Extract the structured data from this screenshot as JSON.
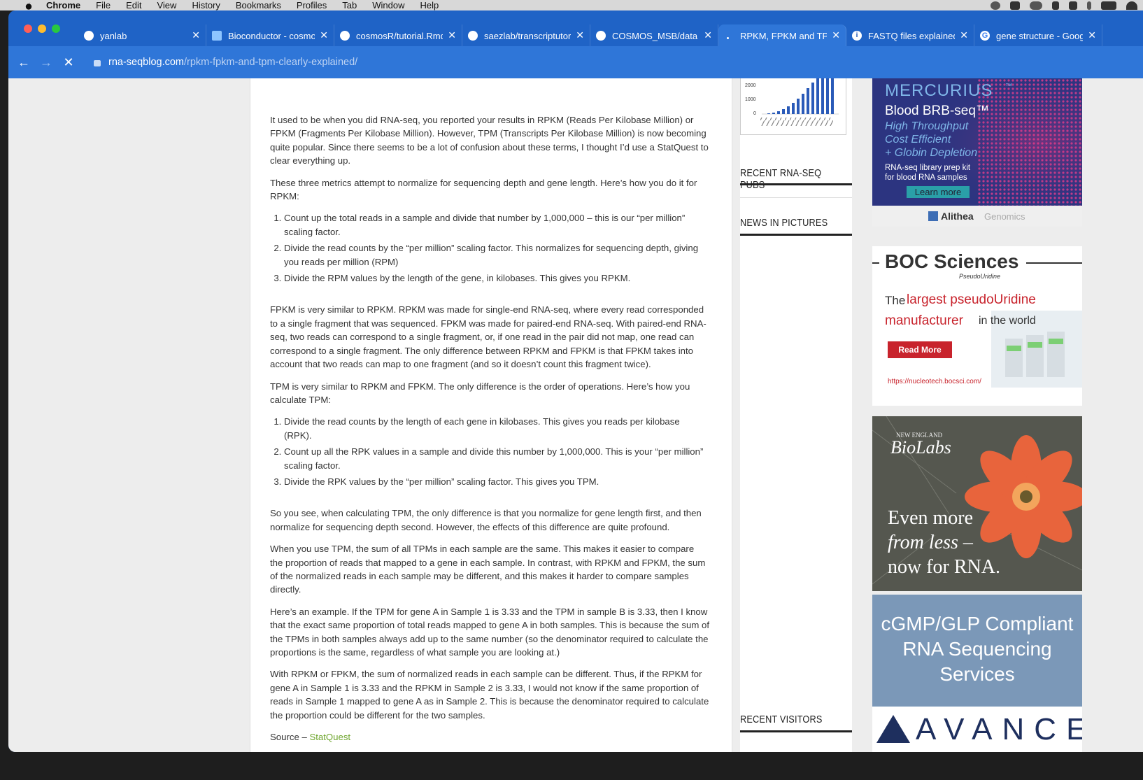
{
  "menubar": {
    "app": "Chrome",
    "items": [
      "File",
      "Edit",
      "View",
      "History",
      "Bookmarks",
      "Profiles",
      "Tab",
      "Window",
      "Help"
    ]
  },
  "tabs": [
    {
      "title": "yanlab",
      "icon": "github-icon"
    },
    {
      "title": "Bioconductor - cosmo",
      "icon": "bioconductor-icon"
    },
    {
      "title": "cosmosR/tutorial.Rmd",
      "icon": "github-icon"
    },
    {
      "title": "saezlab/transcriptutor",
      "icon": "github-icon"
    },
    {
      "title": "COSMOS_MSB/data a",
      "icon": "github-icon"
    },
    {
      "title": "RPKM, FPKM and TPM",
      "icon": "loading-icon",
      "active": true
    },
    {
      "title": "FASTQ files explained",
      "icon": "info-icon"
    },
    {
      "title": "gene structure - Goog",
      "icon": "google-icon"
    }
  ],
  "address": {
    "host": "rna-seqblog.com",
    "path": "/rpkm-fpkm-and-tpm-clearly-explained/"
  },
  "article": {
    "p1": "It used to be when you did RNA-seq, you reported your results in RPKM (Reads Per Kilobase Million) or FPKM (Fragments Per Kilobase Million). However, TPM (Transcripts Per Kilobase Million) is now becoming quite popular. Since there seems to be a lot of confusion about these terms, I thought I’d use a StatQuest to clear everything up.",
    "p2": "These three metrics attempt to normalize for sequencing depth and gene length. Here’s how you do it for RPKM:",
    "rpkm_steps": [
      "Count up the total reads in a sample and divide that number by 1,000,000 – this is our “per million” scaling factor.",
      "Divide the read counts by the “per million” scaling factor. This normalizes for sequencing depth, giving you reads per million (RPM)",
      "Divide the RPM values by the length of the gene, in kilobases. This gives you RPKM."
    ],
    "p3": "FPKM is very similar to RPKM. RPKM was made for single-end RNA-seq, where every read corresponded to a single fragment that was sequenced. FPKM was made for paired-end RNA-seq. With paired-end RNA-seq, two reads can correspond to a single fragment, or, if one read in the pair did not map, one read can correspond to a single fragment. The only difference between RPKM and FPKM is that FPKM takes into account that two reads can map to one fragment (and so it doesn’t count this fragment twice).",
    "p4": "TPM is very similar to RPKM and FPKM. The only difference is the order of operations. Here’s how you calculate TPM:",
    "tpm_steps": [
      "Divide the read counts by the length of each gene in kilobases. This gives you reads per kilobase (RPK).",
      "Count up all the RPK values in a sample and divide this number by 1,000,000. This is your “per million” scaling factor.",
      "Divide the RPK values by the “per million” scaling factor. This gives you TPM."
    ],
    "p5": "So you see, when calculating TPM, the only difference is that you normalize for gene length first, and then normalize for sequencing depth second. However, the effects of this difference are quite profound.",
    "p6": "When you use TPM, the sum of all TPMs in each sample are the same. This makes it easier to compare the proportion of reads that mapped to a gene in each sample. In contrast, with RPKM and FPKM, the sum of the normalized reads in each sample may be different, and this makes it harder to compare samples directly.",
    "p7": "Here’s an example. If the TPM for gene A in Sample 1 is 3.33 and the TPM in sample B is 3.33, then I know that the exact same proportion of total reads mapped to gene A in both samples. This is because the sum of the TPMs in both samples always add up to the same number (so the denominator required to calculate the proportions is the same, regardless of what sample you are looking at.)",
    "p8": "With RPKM or FPKM, the sum of normalized reads in each sample can be different. Thus, if the RPKM for gene A in Sample 1 is 3.33 and the RPKM in Sample 2 is 3.33, I would not know if the same proportion of reads in Sample 1 mapped to gene A as in Sample 2. This is because the denominator required to calculate the proportion could be different for the two samples.",
    "source_prefix": "Source – ",
    "source_link": "StatQuest"
  },
  "sidebar": {
    "chart_ticks": [
      "2000",
      "1000",
      "0"
    ],
    "recent_pubs": "RECENT RNA-SEQ PUBS",
    "news": "NEWS IN PICTURES",
    "visitors": "RECENT VISITORS"
  },
  "ads": {
    "ad1": {
      "brand": "MERCURIUS",
      "tm": "™",
      "product": "Blood BRB-seq™",
      "lines": [
        "High Throughput",
        "Cost Efficient",
        "+ Globin Depletion"
      ],
      "sub1": "RNA-seq library prep kit",
      "sub2": "for blood RNA samples",
      "button": "Learn more",
      "footer_a": "Alithea",
      "footer_b": "Genomics"
    },
    "ad2": {
      "brand": "BOC Sciences",
      "sub": "PseudoUridine",
      "line1a": "The ",
      "line1b": "largest pseudoUridine",
      "line2a": "manufacturer",
      "line2b": " in the world",
      "button": "Read More",
      "url": "https://nucleotech.bocsci.com/"
    },
    "ad3": {
      "brand_top": "NEW ENGLAND",
      "brand": "BioLabs",
      "line1": "Even more",
      "line2": "from less –",
      "line3": "now for RNA."
    },
    "ad4": {
      "line1": "cGMP/GLP Compliant",
      "line2": "RNA Sequencing",
      "line3": "Services",
      "brand": "AVANCE"
    }
  },
  "colors": {
    "chrome_blue": "#2f76d8",
    "link_green": "#6ea52d",
    "boc_red": "#c8232c"
  }
}
